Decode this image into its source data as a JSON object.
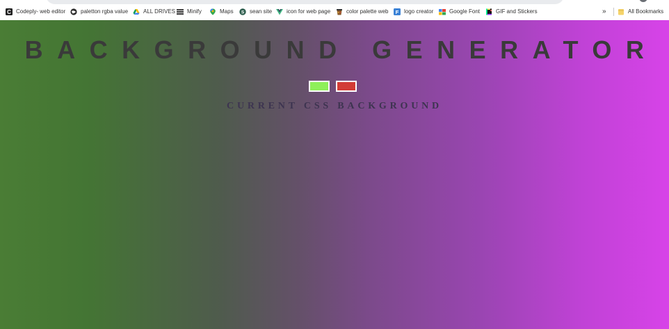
{
  "bookmarks": [
    {
      "label": "Codeply- web editor",
      "icon": "codeply-c-icon"
    },
    {
      "label": "paletton rgba value",
      "icon": "paletton-globe-icon"
    },
    {
      "label": "ALL DRIVES",
      "icon": "google-drive-icon"
    },
    {
      "label": "Minify",
      "icon": "minify-stack-icon"
    },
    {
      "label": "Maps",
      "icon": "maps-pin-icon"
    },
    {
      "label": "sean site",
      "icon": "sean-site-icon"
    },
    {
      "label": "icon for web page",
      "icon": "vue-v-icon"
    },
    {
      "label": "color palette web",
      "icon": "color-palette-cup-icon"
    },
    {
      "label": "logo creator",
      "icon": "logo-creator-f-icon"
    },
    {
      "label": "Google Font",
      "icon": "google-fonts-icon"
    },
    {
      "label": "GIF and Stickers",
      "icon": "giphy-icon"
    }
  ],
  "overflow_label": "»",
  "all_bookmarks_label": "All Bookmarks",
  "page": {
    "title": "BACKGROUND GENERATOR",
    "heading": "CURRENT CSS BACKGROUND",
    "color1": "#8ff05a",
    "color2": "#d23c36",
    "gradient_start": "#4a7d35",
    "gradient_end": "#d743e8"
  }
}
